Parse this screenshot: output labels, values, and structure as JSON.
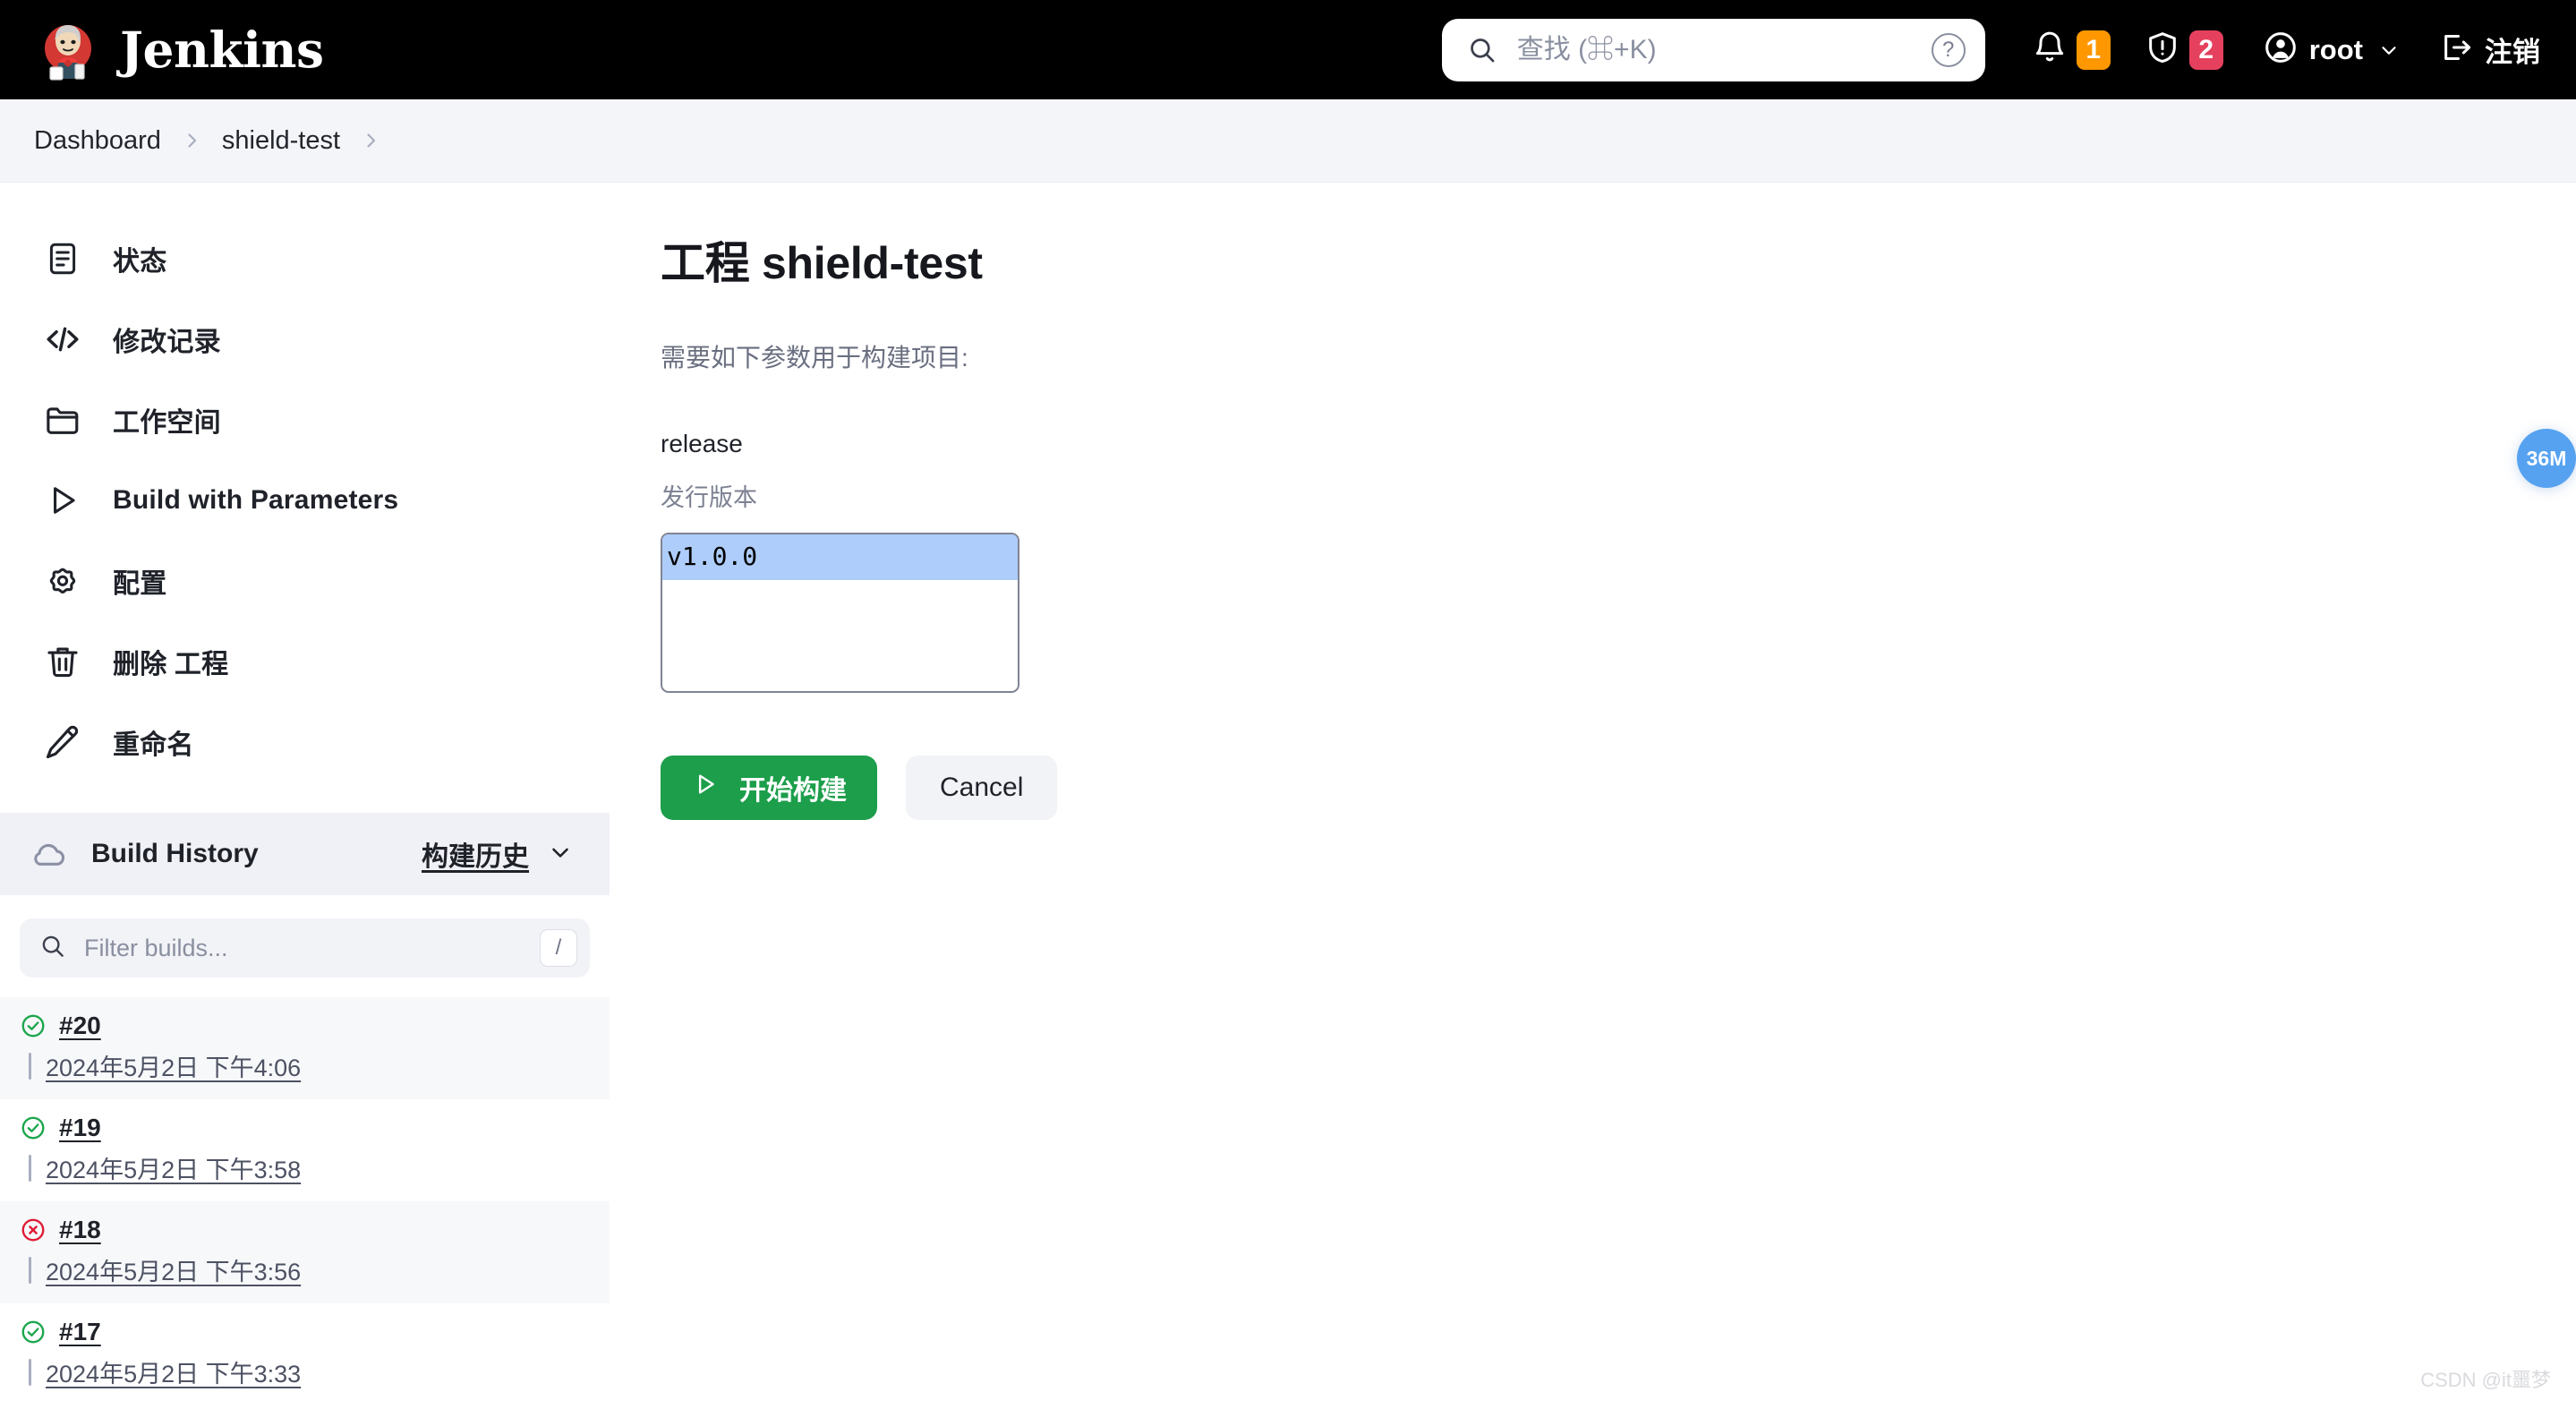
{
  "app": {
    "brand_name": "Jenkins",
    "logo_icon": "jenkins-butler-logo"
  },
  "header": {
    "search": {
      "placeholder": "查找 (⌘+K)",
      "value": "",
      "icon": "search-icon",
      "help_icon": "question-circle-icon",
      "help_label": "?"
    },
    "notifications": {
      "icon": "bell-icon",
      "count": "1",
      "color": "#ff9800"
    },
    "security": {
      "icon": "shield-exclamation-icon",
      "count": "2",
      "color": "#e5415e"
    },
    "user": {
      "icon": "user-circle-icon",
      "name": "root",
      "chevron_icon": "chevron-down-icon"
    },
    "logout": {
      "icon": "logout-icon",
      "label": "注销"
    }
  },
  "breadcrumb": {
    "items": [
      {
        "label": "Dashboard"
      },
      {
        "label": "shield-test"
      }
    ],
    "separator_icon": "chevron-right-icon"
  },
  "sidebar": {
    "nav_items": [
      {
        "label": "状态",
        "icon": "document-lines-icon"
      },
      {
        "label": "修改记录",
        "icon": "code-brackets-icon"
      },
      {
        "label": "工作空间",
        "icon": "folder-icon"
      },
      {
        "label": "Build with Parameters",
        "icon": "play-triangle-icon"
      },
      {
        "label": "配置",
        "icon": "gear-icon"
      },
      {
        "label": "删除 工程",
        "icon": "trash-icon"
      },
      {
        "label": "重命名",
        "icon": "pencil-icon"
      }
    ],
    "build_history": {
      "title": "Build History",
      "cloud_icon": "cloud-icon",
      "link_label": "构建历史",
      "chevron_icon": "chevron-down-icon",
      "filter": {
        "placeholder": "Filter builds...",
        "value": "",
        "icon": "search-icon",
        "shortcut_key": "/"
      },
      "builds": [
        {
          "number": "#20",
          "date": "2024年5月2日 下午4:06",
          "status": "success",
          "status_icon": "check-circle-icon",
          "status_color": "#1ca64c"
        },
        {
          "number": "#19",
          "date": "2024年5月2日 下午3:58",
          "status": "success",
          "status_icon": "check-circle-icon",
          "status_color": "#1ca64c"
        },
        {
          "number": "#18",
          "date": "2024年5月2日 下午3:56",
          "status": "failed",
          "status_icon": "x-circle-icon",
          "status_color": "#e01b34"
        },
        {
          "number": "#17",
          "date": "2024年5月2日 下午3:33",
          "status": "success",
          "status_icon": "check-circle-icon",
          "status_color": "#1ca64c"
        }
      ]
    }
  },
  "main": {
    "page_title": "工程 shield-test",
    "intro_text": "需要如下参数用于构建项目:",
    "parameter": {
      "name": "release",
      "description": "发行版本",
      "options": [
        "v1.0.0"
      ],
      "selected": "v1.0.0"
    },
    "buttons": {
      "build_label": "开始构建",
      "build_icon": "play-triangle-icon",
      "cancel_label": "Cancel"
    }
  },
  "floating_widget": {
    "label": "36M"
  },
  "watermark": {
    "text": "CSDN @it噩梦"
  }
}
